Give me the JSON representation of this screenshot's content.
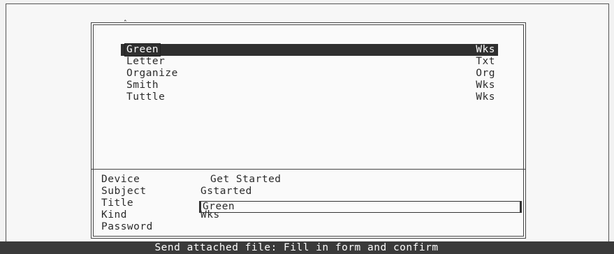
{
  "file_list": {
    "items": [
      {
        "name": "Green",
        "kind": "Wks",
        "selected": true
      },
      {
        "name": "Letter",
        "kind": "Txt",
        "selected": false
      },
      {
        "name": "Organize",
        "kind": "Org",
        "selected": false
      },
      {
        "name": "Smith",
        "kind": "Wks",
        "selected": false
      },
      {
        "name": "Tuttle",
        "kind": "Wks",
        "selected": false
      }
    ]
  },
  "form": {
    "device_label": "Device",
    "device_value": "Get Started",
    "subject_label": "Subject",
    "subject_value": "Gstarted",
    "title_label": "Title",
    "title_value": "Green",
    "kind_label": "Kind",
    "kind_value": "Wks",
    "password_label": "Password"
  },
  "status_bar": {
    "text": "Send attached file: Fill in form and confirm"
  }
}
